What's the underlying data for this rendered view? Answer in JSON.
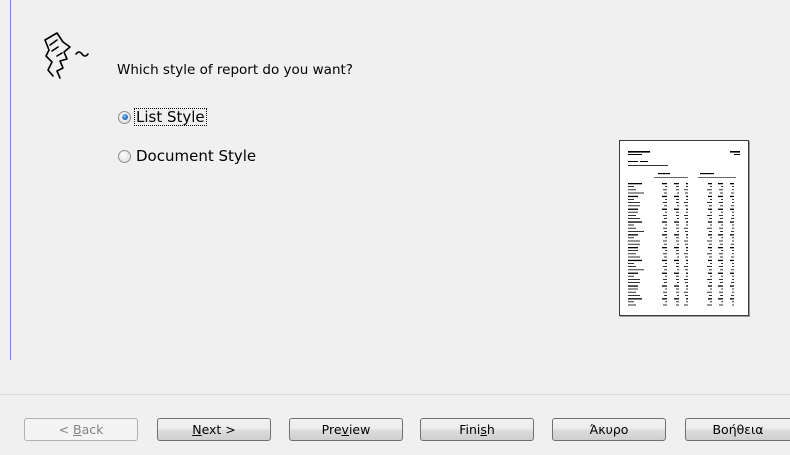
{
  "wizard": {
    "question": "Which style of report do you want?",
    "options": [
      {
        "label": "List Style",
        "checked": true
      },
      {
        "label": "Document Style",
        "checked": false
      }
    ],
    "preview_icon": "report-preview-thumbnail",
    "wizard_icon": "wizard-face-icon"
  },
  "buttons": {
    "back": {
      "pre": "< ",
      "key": "B",
      "post": "ack",
      "enabled": false
    },
    "next": {
      "pre": "",
      "key": "N",
      "post": "ext >",
      "enabled": true
    },
    "preview": {
      "pre": "Pre",
      "key": "v",
      "post": "iew",
      "enabled": true
    },
    "finish": {
      "pre": "Fini",
      "key": "s",
      "post": "h",
      "enabled": true
    },
    "cancel": {
      "label": "Άκυρο",
      "enabled": true
    },
    "help": {
      "label": "Βοήθεια",
      "enabled": true
    }
  },
  "colors": {
    "accent_line": "#6f86c4",
    "radio_selected": "#2a76c9",
    "background": "#f0f0f0"
  }
}
